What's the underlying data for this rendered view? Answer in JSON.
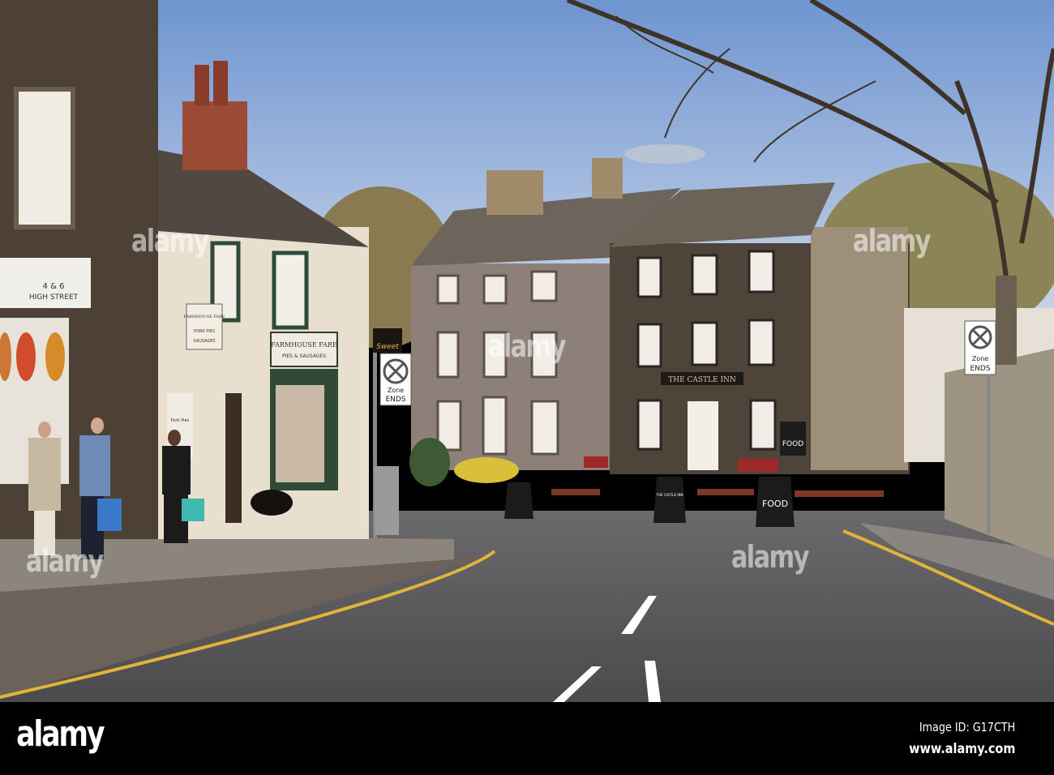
{
  "footer": {
    "logo": "alamy",
    "image_id": "Image ID: G17CTH",
    "url": "www.alamy.com"
  },
  "watermark": "alamy",
  "signs": {
    "shop_number": "4 & 6",
    "shop_street": "HIGH STREET",
    "farmhouse_hanging": "FARMHOUSE FARE",
    "farmhouse_hanging_sub1": "PORK PIES",
    "farmhouse_hanging_sub2": "SAUSAGES",
    "farmhouse_board": "FARMHOUSE FARE",
    "farmhouse_board_sub": "PIES & SAUSAGES",
    "farmhouse_door": "Pork Pies",
    "sweet_shop": "Sweet",
    "zone_left": "Zone",
    "zone_left_2": "ENDS",
    "zone_right": "Zone",
    "zone_right_2": "ENDS",
    "pub_name": "THE CASTLE INN",
    "food_board": "FOOD",
    "food_board_right": "FOOD",
    "aboard_center": "THE CASTLE INN"
  },
  "colors": {
    "sky": "#8fb0dc",
    "stone_dark": "#4a3f35",
    "cream": "#e9dfcf",
    "road": "#5a5a5c",
    "line_yellow": "#e0b43a"
  }
}
